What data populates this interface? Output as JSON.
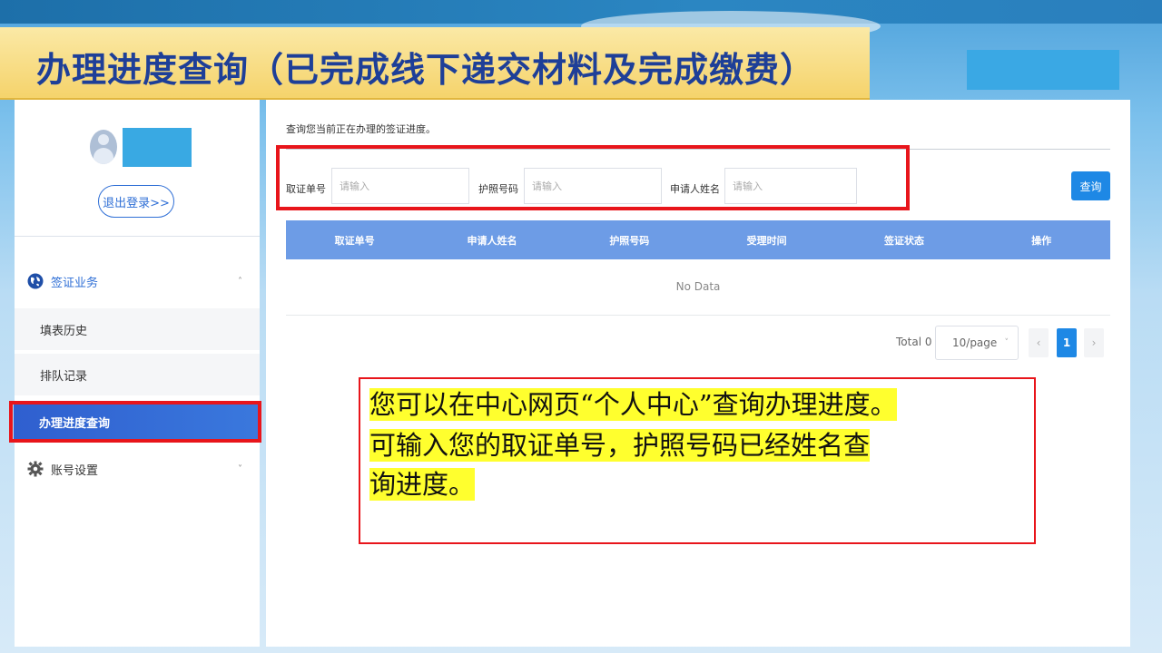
{
  "page": {
    "title": "办理进度查询（已完成线下递交材料及完成缴费）",
    "colors": {
      "title_text": "#1e3f98",
      "banner": "#f5d36b",
      "accent": "#1e88e5",
      "highlight_border": "#e8151b",
      "callout_highlight": "#ffff2e"
    }
  },
  "sidebar": {
    "logout_label": "退出登录>>",
    "groups": [
      {
        "label": "签证业务",
        "icon": "globe-icon",
        "expanded_chevron": "˄"
      },
      {
        "label": "账号设置",
        "icon": "gear-icon",
        "expanded_chevron": "˅"
      }
    ],
    "items": [
      {
        "label": "填表历史"
      },
      {
        "label": "排队记录"
      },
      {
        "label": "办理进度查询",
        "active": true
      }
    ]
  },
  "main": {
    "description": "查询您当前正在办理的签证进度。",
    "fields": [
      {
        "label": "取证单号",
        "placeholder": "请输入"
      },
      {
        "label": "护照号码",
        "placeholder": "请输入"
      },
      {
        "label": "申请人姓名",
        "placeholder": "请输入"
      }
    ],
    "query_button": "查询",
    "table": {
      "columns": [
        "取证单号",
        "申请人姓名",
        "护照号码",
        "受理时间",
        "签证状态",
        "操作"
      ],
      "empty_text": "No Data"
    },
    "pagination": {
      "total_label": "Total 0",
      "page_size": "10/page",
      "prev": "‹",
      "current_page": "1",
      "next": "›"
    }
  },
  "callout": {
    "lines": [
      "您可以在中心网页“个人中心”查询办理进度。",
      "可输入您的取证单号，护照号码已经姓名查",
      "询进度。"
    ]
  }
}
